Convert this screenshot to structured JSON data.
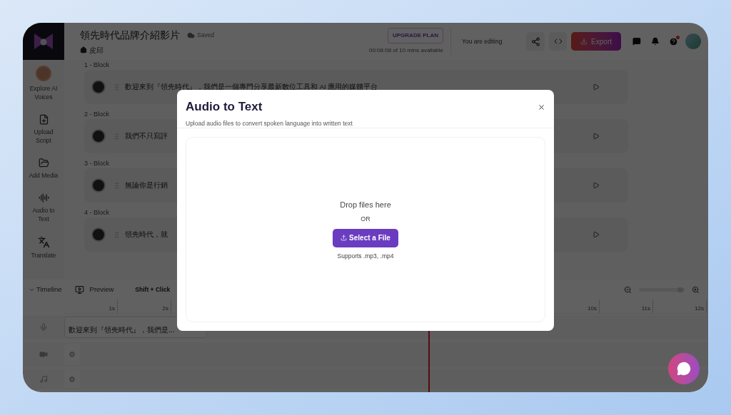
{
  "header": {
    "title": "領先時代品牌介紹影片",
    "save_status": "Saved",
    "breadcrumb": "皮邱",
    "upgrade_button": "UPGRADE PLAN",
    "usage": "00:08:08 of 10 mins available",
    "editing_status": "You are editing",
    "export_button": "Export"
  },
  "sidebar": [
    {
      "kind": "avatar",
      "label": "Explore AI Voices"
    },
    {
      "kind": "upload",
      "label": "Upload Script"
    },
    {
      "kind": "media",
      "label": "Add Media"
    },
    {
      "kind": "audio",
      "label": "Audio to Text"
    },
    {
      "kind": "translate",
      "label": "Translate"
    }
  ],
  "blocks": [
    {
      "heading": "1 -  Block",
      "text": "歡迎來到『領先時代』，我們是一個專門分享最新數位工具和 AI 應用的媒體平台"
    },
    {
      "heading": "2 -  Block",
      "text": "我們不只寫評"
    },
    {
      "heading": "3 -  Block",
      "text": "無論你是行銷"
    },
    {
      "heading": "4 -  Block",
      "text": "領先時代，就"
    }
  ],
  "timeline": {
    "toggle": "Timeline",
    "preview": "Preview",
    "hint": "Shift + Click",
    "zoom": {
      "level": 0.9
    },
    "ruler": [
      "1s",
      "2s",
      "10s",
      "11s",
      "12s"
    ],
    "clip": "歡迎來到『領先時代』，我們是..."
  },
  "dialog": {
    "title": "Audio to Text",
    "subtitle": "Upload audio files to convert spoken language into written text",
    "drop_text": "Drop files here",
    "separator": "OR",
    "button": "Select a File",
    "supports": "Supports .mp3, .mp4"
  }
}
